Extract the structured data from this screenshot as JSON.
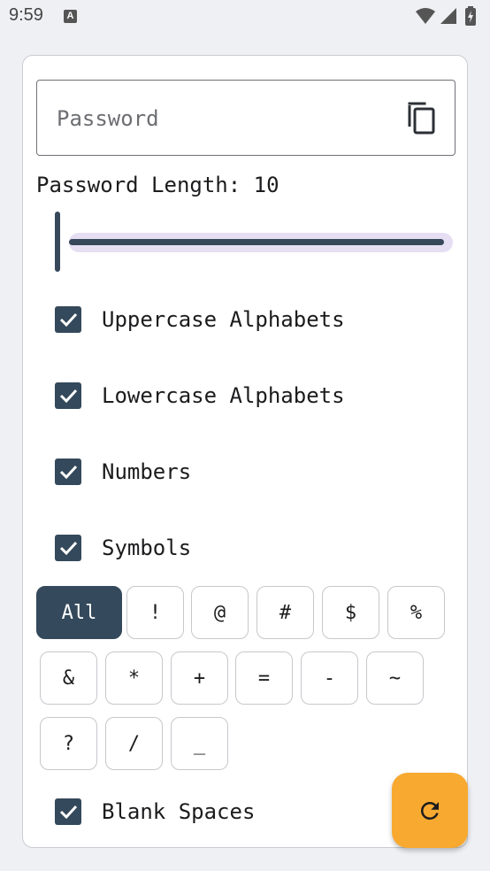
{
  "status_bar": {
    "time": "9:59",
    "icons": [
      "keyboard-a-icon",
      "wifi-icon",
      "signal-icon",
      "battery-icon"
    ]
  },
  "password_field": {
    "placeholder": "Password",
    "value": "",
    "copy_icon": "copy-icon"
  },
  "length": {
    "label": "Password Length: 10",
    "value": 10,
    "slider_fraction": 0.0
  },
  "options": [
    {
      "label": "Uppercase Alphabets",
      "checked": true
    },
    {
      "label": "Lowercase Alphabets",
      "checked": true
    },
    {
      "label": "Numbers",
      "checked": true
    },
    {
      "label": "Symbols",
      "checked": true
    }
  ],
  "symbols": {
    "all_label": "All",
    "all_selected": true,
    "rows": [
      [
        "!",
        "@",
        "#",
        "$",
        "%"
      ],
      [
        "&",
        "*",
        "+",
        "=",
        "-",
        "~"
      ],
      [
        "?",
        "/",
        "_"
      ]
    ]
  },
  "blank_spaces": {
    "label": "Blank Spaces",
    "checked": true
  },
  "fab": {
    "icon": "refresh-icon"
  },
  "colors": {
    "accent_dark": "#34495b",
    "fab": "#f8a930",
    "slider_track": "#e6def3"
  }
}
